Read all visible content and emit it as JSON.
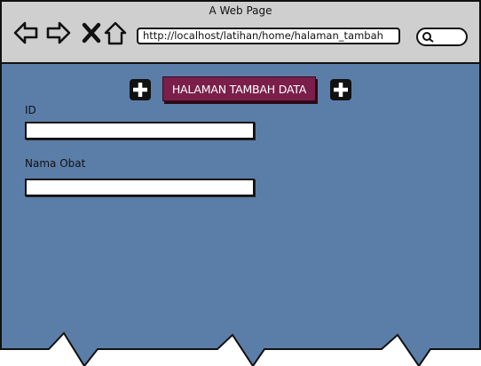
{
  "window": {
    "title": "A Web Page"
  },
  "browser": {
    "url": "http://localhost/latihan/home/halaman_tambah",
    "icons": {
      "back": "back-arrow-icon",
      "forward": "forward-arrow-icon",
      "stop": "close-icon",
      "home": "home-icon",
      "search": "search-icon"
    }
  },
  "page": {
    "header_label": "HALAMAN TAMBAH DATA",
    "left_button_icon": "plus-icon",
    "right_button_icon": "plus-icon",
    "fields": [
      {
        "label": "ID",
        "value": ""
      },
      {
        "label": "Nama Obat",
        "value": ""
      }
    ]
  },
  "colors": {
    "page_background": "#5b7ea9",
    "chrome_background": "#cfcfcf",
    "header_button": "#7a1f4a"
  }
}
